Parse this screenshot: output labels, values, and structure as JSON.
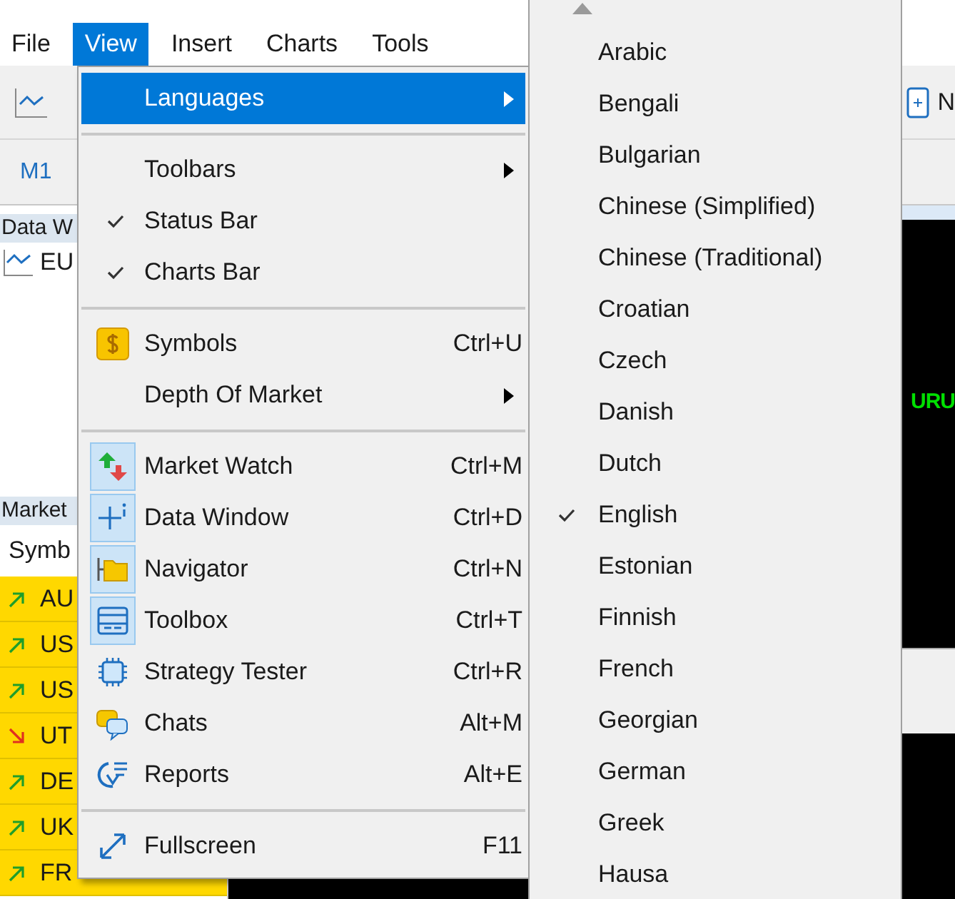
{
  "menubar": [
    {
      "label": "File",
      "selected": false
    },
    {
      "label": "View",
      "selected": true
    },
    {
      "label": "Insert",
      "selected": false
    },
    {
      "label": "Charts",
      "selected": false
    },
    {
      "label": "Tools",
      "selected": false
    }
  ],
  "toolbar": {
    "button": "N"
  },
  "timeframes": [
    "M1"
  ],
  "data_window": {
    "title": "Data W",
    "rows": [
      "EU"
    ]
  },
  "market_watch": {
    "title": "Market",
    "column": "Symb",
    "rows": [
      {
        "symbol": "AU",
        "kind": "rising"
      },
      {
        "symbol": "US",
        "kind": "rising"
      },
      {
        "symbol": "US",
        "kind": "rising"
      },
      {
        "symbol": "UT",
        "kind": "falling"
      },
      {
        "symbol": "DE",
        "kind": "rising"
      },
      {
        "symbol": "UK",
        "kind": "rising"
      },
      {
        "symbol": "FR",
        "kind": "rising"
      }
    ]
  },
  "chart": {
    "text": "URU"
  },
  "view_menu": {
    "items": [
      {
        "kind": "submenu",
        "label": "Languages",
        "selected": true
      },
      {
        "kind": "separator"
      },
      {
        "kind": "submenu",
        "label": "Toolbars",
        "selected": false
      },
      {
        "kind": "toggle",
        "label": "Status Bar",
        "checked": true
      },
      {
        "kind": "toggle",
        "label": "Charts Bar",
        "checked": true
      },
      {
        "kind": "separator"
      },
      {
        "kind": "command",
        "label": "Symbols",
        "shortcut": "Ctrl+U",
        "checked": false
      },
      {
        "kind": "submenu",
        "label": "Depth Of Market",
        "selected": false
      },
      {
        "kind": "separator"
      },
      {
        "kind": "command",
        "label": "Market Watch",
        "shortcut": "Ctrl+M",
        "checked": true
      },
      {
        "kind": "command",
        "label": "Data Window",
        "shortcut": "Ctrl+D",
        "checked": true
      },
      {
        "kind": "command",
        "label": "Navigator",
        "shortcut": "Ctrl+N",
        "checked": true
      },
      {
        "kind": "command",
        "label": "Toolbox",
        "shortcut": "Ctrl+T",
        "checked": true
      },
      {
        "kind": "command",
        "label": "Strategy Tester",
        "shortcut": "Ctrl+R",
        "checked": false
      },
      {
        "kind": "command",
        "label": "Chats",
        "shortcut": "Alt+M",
        "checked": false
      },
      {
        "kind": "command",
        "label": "Reports",
        "shortcut": "Alt+E",
        "checked": false
      },
      {
        "kind": "separator"
      },
      {
        "kind": "command",
        "label": "Fullscreen",
        "shortcut": "F11",
        "checked": false
      }
    ]
  },
  "languages_menu": {
    "items": [
      {
        "label": "Arabic",
        "checked": false
      },
      {
        "label": "Bengali",
        "checked": false
      },
      {
        "label": "Bulgarian",
        "checked": false
      },
      {
        "label": "Chinese (Simplified)",
        "checked": false
      },
      {
        "label": "Chinese (Traditional)",
        "checked": false
      },
      {
        "label": "Croatian",
        "checked": false
      },
      {
        "label": "Czech",
        "checked": false
      },
      {
        "label": "Danish",
        "checked": false
      },
      {
        "label": "Dutch",
        "checked": false
      },
      {
        "label": "English",
        "checked": true
      },
      {
        "label": "Estonian",
        "checked": false
      },
      {
        "label": "Finnish",
        "checked": false
      },
      {
        "label": "French",
        "checked": false
      },
      {
        "label": "Georgian",
        "checked": false
      },
      {
        "label": "German",
        "checked": false
      },
      {
        "label": "Greek",
        "checked": false
      },
      {
        "label": "Hausa",
        "checked": false
      }
    ]
  }
}
